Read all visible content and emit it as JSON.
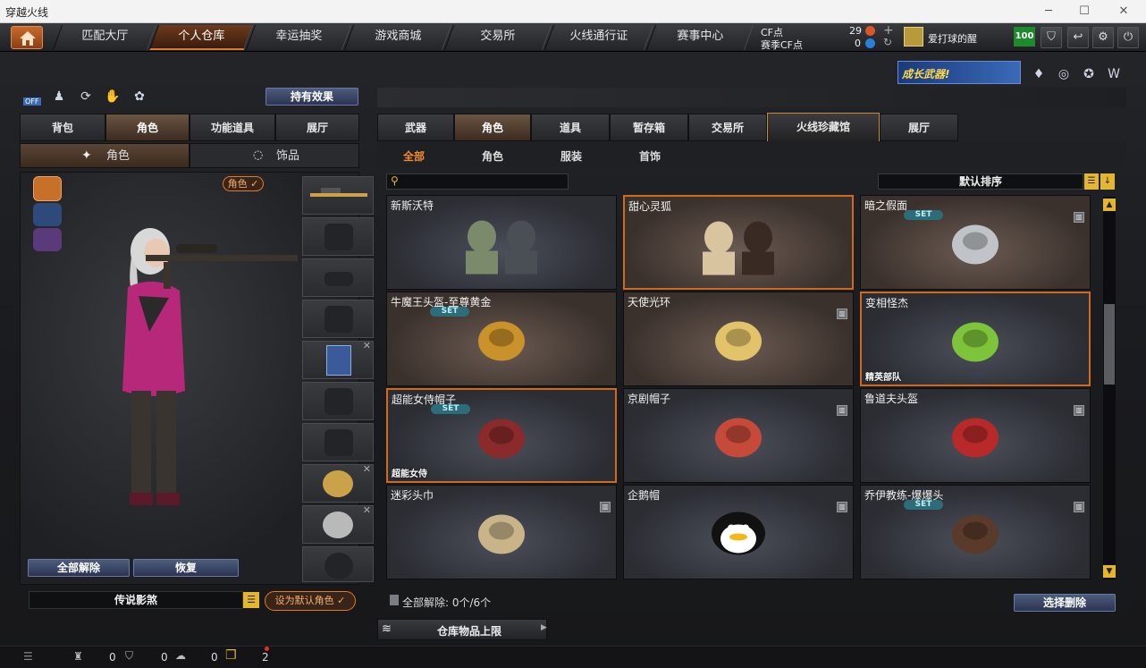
{
  "window": {
    "title": "穿越火线",
    "minimize": "─",
    "maximize": "☐",
    "close": "✕"
  },
  "nav": {
    "tabs": [
      "匹配大厅",
      "个人仓库",
      "幸运抽奖",
      "游戏商城",
      "交易所",
      "火线通行证",
      "赛事中心"
    ],
    "active": 1
  },
  "currency": {
    "cf_label": "CF点",
    "cf_value": "29",
    "event_label": "赛季CF点",
    "event_value": "0"
  },
  "user": {
    "name": "爱打球的醒",
    "level": "100"
  },
  "banner": {
    "text": "成长武器!"
  },
  "effects_button": "持有效果",
  "off_label": "OFF",
  "left_tabs": [
    "背包",
    "角色",
    "功能道具",
    "展厅"
  ],
  "left_active": 1,
  "char_subtabs": [
    "角色",
    "饰品"
  ],
  "char_badge": "角色",
  "unequip_all": "全部解除",
  "restore": "恢复",
  "char_name": "传说影煞",
  "set_default": "设为默认角色",
  "inv_tabs": [
    "武器",
    "角色",
    "道具",
    "暂存箱",
    "交易所",
    "火线珍藏馆",
    "展厅"
  ],
  "inv_active": 1,
  "filter_tabs": [
    "全部",
    "角色",
    "服装",
    "首饰"
  ],
  "filter_active": 0,
  "search": {
    "placeholder": ""
  },
  "sort": {
    "label": "默认排序"
  },
  "items": [
    {
      "name": "新斯沃特",
      "set": false,
      "trash": false,
      "tag": "",
      "highlight": false,
      "warm": false
    },
    {
      "name": "甜心灵狐",
      "set": false,
      "trash": false,
      "tag": "",
      "highlight": true,
      "warm": true
    },
    {
      "name": "暗之假面",
      "set": true,
      "trash": true,
      "tag": "",
      "highlight": false,
      "warm": true
    },
    {
      "name": "牛魔王头盔-至尊黄金",
      "set": true,
      "trash": false,
      "tag": "",
      "highlight": false,
      "warm": true
    },
    {
      "name": "天使光环",
      "set": false,
      "trash": true,
      "tag": "",
      "highlight": false,
      "warm": true
    },
    {
      "name": "变相怪杰",
      "set": false,
      "trash": false,
      "tag": "精英部队",
      "highlight": true,
      "warm": false
    },
    {
      "name": "超能女侍帽子",
      "set": true,
      "trash": false,
      "tag": "超能女侍",
      "highlight": true,
      "warm": false
    },
    {
      "name": "京剧帽子",
      "set": false,
      "trash": true,
      "tag": "",
      "highlight": false,
      "warm": false
    },
    {
      "name": "鲁道夫头盔",
      "set": false,
      "trash": true,
      "tag": "",
      "highlight": false,
      "warm": false
    },
    {
      "name": "迷彩头巾",
      "set": false,
      "trash": true,
      "tag": "",
      "highlight": false,
      "warm": false
    },
    {
      "name": "企鹅帽",
      "set": false,
      "trash": true,
      "tag": "",
      "highlight": false,
      "warm": false
    },
    {
      "name": "乔伊教练-爆爆头",
      "set": true,
      "trash": true,
      "tag": "",
      "highlight": false,
      "warm": false
    }
  ],
  "set_label": "SET",
  "unequip_summary": "全部解除: 0个/6个",
  "select_delete": "选择删除",
  "storage_limit": "仓库物品上限",
  "status": {
    "v1": "0",
    "v2": "0",
    "v3": "0",
    "v4": "2"
  },
  "colors": {
    "accent": "#e07a2a",
    "highlight": "#d06a22",
    "button": "#2b3552",
    "scroll": "#e4b52e"
  }
}
